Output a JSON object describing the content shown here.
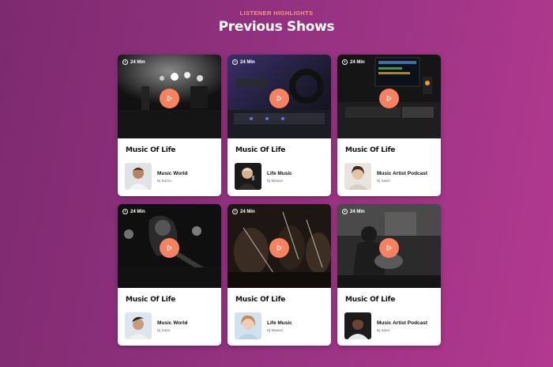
{
  "section": {
    "eyebrow": "LISTENER HIGHLIGHTS",
    "title": "Previous Shows"
  },
  "colors": {
    "accent": "#f8815f",
    "eyebrow": "#f49a7c"
  },
  "cards": [
    {
      "duration": "24 Min",
      "title": "Music Of Life",
      "show": "Music World",
      "host": "Dj Sazzo",
      "scene": "concert-stage"
    },
    {
      "duration": "24 Min",
      "title": "Music Of Life",
      "show": "Life Music",
      "host": "Dj Mewon",
      "scene": "headphones-mixer"
    },
    {
      "duration": "24 Min",
      "title": "Music Of Life",
      "show": "Music Artist Podcast",
      "host": "Dj Sassi",
      "scene": "studio-desk"
    },
    {
      "duration": "24 Min",
      "title": "Music Of Life",
      "show": "Music World",
      "host": "Dj Sassi",
      "scene": "guitarist-performer"
    },
    {
      "duration": "24 Min",
      "title": "Music Of Life",
      "show": "Life Music",
      "host": "Dj Mewon",
      "scene": "orchestra-violins"
    },
    {
      "duration": "24 Min",
      "title": "Music Of Life",
      "show": "Music Artist Podcast",
      "host": "Dj Sassi",
      "scene": "guitar-player-bw"
    }
  ]
}
